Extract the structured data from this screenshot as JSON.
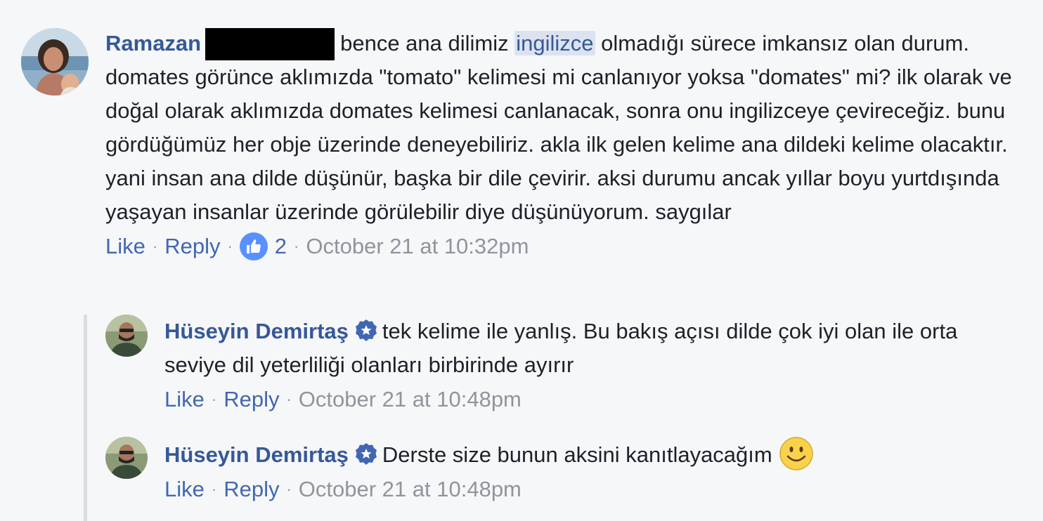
{
  "main_comment": {
    "author": "Ramazan",
    "text_before_tag": "bence ana dilimiz",
    "tagged_word": "ingilizce",
    "text_after_tag": "olmadığı sürece imkansız olan durum. domates görünce aklımızda \"tomato\" kelimesi mi canlanıyor yoksa \"domates\" mi? ilk olarak ve doğal olarak aklımızda domates kelimesi canlanacak, sonra onu ingilizceye çevireceğiz. bunu gördüğümüz her obje üzerinde deneyebiliriz. akla ilk gelen kelime ana dildeki kelime olacaktır. yani insan ana dilde düşünür, başka bir dile çevirir. aksi durumu ancak yıllar boyu yurtdışında yaşayan insanlar üzerinde görülebilir diye düşünüyorum. saygılar",
    "like_label": "Like",
    "reply_label": "Reply",
    "separator": "·",
    "reaction_count": "2",
    "timestamp": "October 21 at 10:32pm"
  },
  "replies": [
    {
      "author": "Hüseyin Demirtaş",
      "text": "tek kelime ile yanlış. Bu bakış açısı dilde çok iyi olan ile orta seviye dil yeterliliği olanları birbirinde ayırır",
      "like_label": "Like",
      "reply_label": "Reply",
      "timestamp": "October 21 at 10:48pm"
    },
    {
      "author": "Hüseyin Demirtaş",
      "text": "Derste size bunun aksini kanıtlayacağım",
      "emoji": "smiley-face-icon",
      "like_label": "Like",
      "reply_label": "Reply",
      "timestamp": "October 21 at 10:48pm"
    }
  ],
  "colors": {
    "author": "#365899",
    "link": "#4267b2",
    "meta": "#90949c",
    "background": "#f6f7f9",
    "reaction": "#5890ff"
  }
}
